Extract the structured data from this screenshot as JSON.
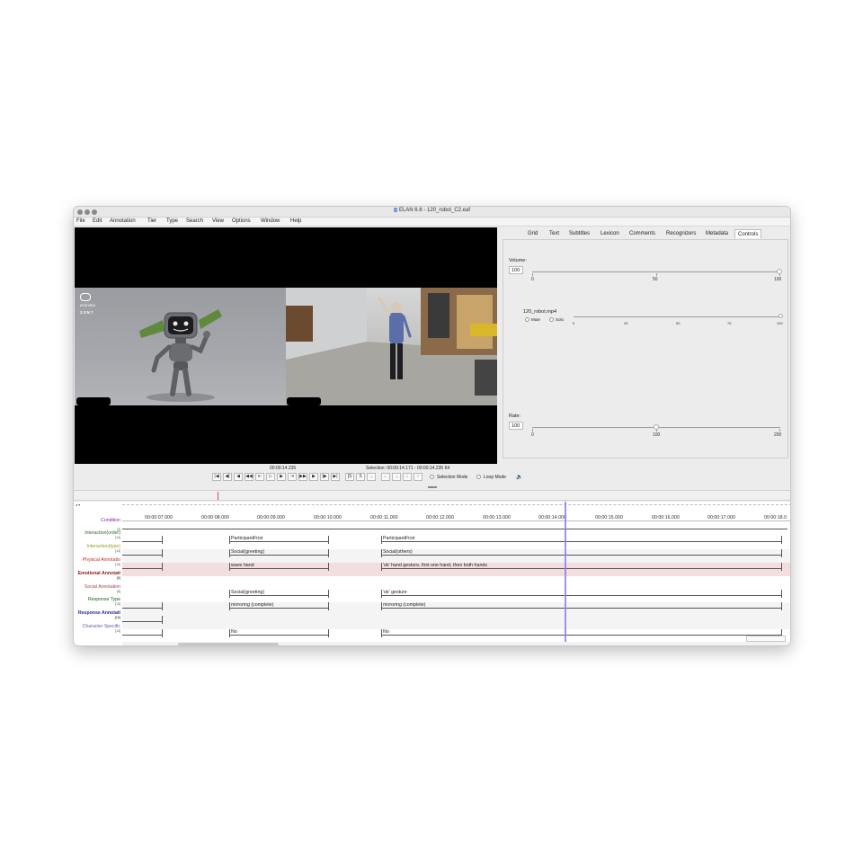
{
  "window": {
    "title": "ELAN 6.6 - 120_robot_C2.eaf"
  },
  "menu": [
    "File",
    "Edit",
    "Annotation",
    "Tier",
    "Type",
    "Search",
    "View",
    "Options",
    "Window",
    "Help"
  ],
  "video": {
    "robot_logo_line1": "ezonimo",
    "robot_logo_line2": "3 3 N 7"
  },
  "tabs": [
    "Grid",
    "Text",
    "Subtitles",
    "Lexicon",
    "Comments",
    "Recognizers",
    "Metadata",
    "Controls"
  ],
  "active_tab": "Controls",
  "controls": {
    "volume_label": "Volume:",
    "volume_value": "100",
    "volume_ticks": [
      "0",
      "50",
      "100"
    ],
    "file_label": "120_robot.mp4",
    "mute_label": "Mute",
    "solo_label": "Solo",
    "file_ticks": [
      "0",
      "25",
      "50",
      "75",
      "100"
    ],
    "rate_label": "Rate:",
    "rate_value": "100",
    "rate_ticks": [
      "0",
      "100",
      "200"
    ]
  },
  "transport": {
    "current_time": "00:00:14.235",
    "selection": "Selection: 00:00:14.171 - 00:00:14.235  64",
    "selection_mode": "Selection Mode",
    "loop_mode": "Loop Mode"
  },
  "ruler": {
    "labels": [
      "00:00:07.000",
      "00:00:08.000",
      "00:00:09.000",
      "00:00:10.000",
      "00:00:11.000",
      "00:00:12.000",
      "00:00:13.000",
      "00:00:14.000",
      "00:00:15.000",
      "00:00:16.000",
      "00:00:17.000",
      "00:00:18.0"
    ]
  },
  "tiers": [
    {
      "name": "Condition",
      "count": "[2]",
      "color": "#7a2aa0"
    },
    {
      "name": "Interaction(order)",
      "count": "[14]",
      "color": "#2e6b2e"
    },
    {
      "name": "Interaction(type)",
      "count": "[13]",
      "color": "#9a9a20"
    },
    {
      "name": "Physical Annotatio",
      "count": "[15]",
      "color": "#c0302a"
    },
    {
      "name": "Emotional Annotati",
      "count": "[0]",
      "color": "#8a1a1a"
    },
    {
      "name": "Social Annotation",
      "count": "[8]",
      "color": "#a04a4a"
    },
    {
      "name": "Response Type",
      "count": "[13]",
      "color": "#1e5a1e"
    },
    {
      "name": "Response Annotati",
      "count": "[10]",
      "color": "#2a2aa0"
    },
    {
      "name": "Character Specific",
      "count": "[13]",
      "color": "#6a5aa0"
    }
  ],
  "annotations": {
    "order_a": "ParticipantFirst",
    "order_b": "ParticipantFirst",
    "type_a": "Social(greeting)",
    "type_b": "Social(others)",
    "physical_a": "wave hand",
    "physical_b": "'ok' hand gesture, first one hand, then both hands",
    "social_a": "Social(greeting)",
    "social_b": "'ok' gesture",
    "response_a": "mirroring (complete)",
    "response_b": "mirroring (complete)",
    "character_a": "No",
    "character_b": "No"
  },
  "colors": {
    "playhead": "#7a6be0",
    "physical_row_bg": "#f2dede"
  }
}
